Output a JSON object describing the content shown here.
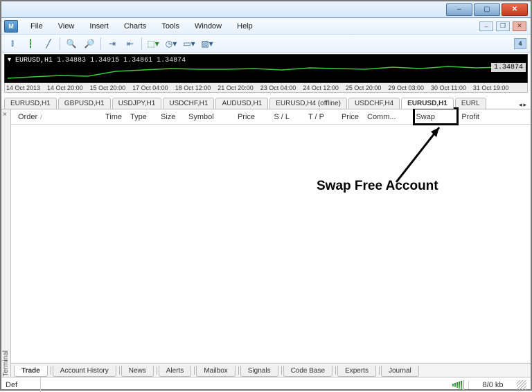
{
  "menu": {
    "file": "File",
    "view": "View",
    "insert": "Insert",
    "charts": "Charts",
    "tools": "Tools",
    "window": "Window",
    "help": "Help"
  },
  "toolbar_badge": "4",
  "ministrip": {
    "symbol": "EURUSD,H1",
    "p1": "1.34883",
    "p2": "1.34915",
    "p3": "1.34861",
    "p4": "1.34874",
    "price_label": "1.34874"
  },
  "timeaxis": [
    "14 Oct 2013",
    "14 Oct 20:00",
    "15 Oct 20:00",
    "17 Oct 04:00",
    "18 Oct 12:00",
    "21 Oct 20:00",
    "23 Oct 04:00",
    "24 Oct 12:00",
    "25 Oct 20:00",
    "29 Oct 03:00",
    "30 Oct 11:00",
    "31 Oct 19:00"
  ],
  "chart_tabs": [
    {
      "label": "EURUSD,H1"
    },
    {
      "label": "GBPUSD,H1"
    },
    {
      "label": "USDJPY,H1"
    },
    {
      "label": "USDCHF,H1"
    },
    {
      "label": "AUDUSD,H1"
    },
    {
      "label": "EURUSD,H4 (offline)"
    },
    {
      "label": "USDCHF,H4"
    },
    {
      "label": "EURUSD,H1",
      "active": true
    },
    {
      "label": "EURL"
    }
  ],
  "terminal": {
    "side_label": "Terminal",
    "columns": {
      "order": "Order",
      "time": "Time",
      "type": "Type",
      "size": "Size",
      "symbol": "Symbol",
      "price": "Price",
      "sl": "S / L",
      "tp": "T / P",
      "price2": "Price",
      "comm": "Comm...",
      "swap": "Swap",
      "profit": "Profit"
    },
    "bottom_tabs": [
      "Trade",
      "Account History",
      "News",
      "Alerts",
      "Mailbox",
      "Signals",
      "Code Base",
      "Experts",
      "Journal"
    ],
    "active_bottom_tab": "Trade"
  },
  "annotation": "Swap Free Account",
  "statusbar": {
    "def": "Def",
    "kb": "8/0 kb"
  }
}
